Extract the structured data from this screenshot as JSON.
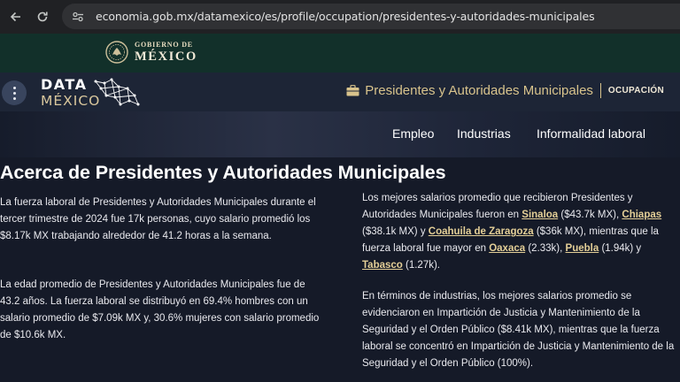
{
  "browser": {
    "url": "economia.gob.mx/datamexico/es/profile/occupation/presidentes-y-autoridades-municipales"
  },
  "gov": {
    "line1": "GOBIERNO DE",
    "line2": "MÉXICO"
  },
  "header": {
    "brand_top": "DATA",
    "brand_bottom": "MÉXICO",
    "profile_name": "Presidentes y Autoridades Municipales",
    "profile_type": "OCUPACIÓN"
  },
  "subnav": {
    "items": [
      "Empleo",
      "Industrias",
      "Informalidad laboral"
    ]
  },
  "about": {
    "title": "Acerca de Presidentes y Autoridades Municipales",
    "p1": "La fuerza laboral de Presidentes y Autoridades Municipales durante el tercer trimestre de 2024 fue 17k personas, cuyo salario promedió los $8.17k MX trabajando alrededor de 41.2 horas a la semana.",
    "p2": "La edad promedio de Presidentes y Autoridades Municipales fue de 43.2 años. La fuerza laboral se distribuyó en 69.4% hombres con un salario promedio de $7.09k MX y, 30.6% mujeres con salario promedio de $10.6k MX.",
    "p3": {
      "t1": "Los mejores salarios promedio que recibieron Presidentes y Autoridades Municipales fueron en ",
      "s1": "Sinaloa",
      "t2": " ($43.7k MX), ",
      "s2": "Chiapas",
      "t3": " ($38.1k MX) y ",
      "s3": "Coahuila de Zaragoza",
      "t4": " ($36k MX), mientras que la fuerza laboral fue mayor en ",
      "s4": "Oaxaca",
      "t5": " (2.33k), ",
      "s5": "Puebla",
      "t6": " (1.94k) y ",
      "s6": "Tabasco",
      "t7": " (1.27k)."
    },
    "p4": "En términos de industrias, los mejores salarios promedio se evidenciaron en Impartición de Justicia y Mantenimiento de la Seguridad y el Orden Público ($8.41k MX), mientras que la fuerza laboral se concentró en Impartición de Justicia y Mantenimiento de la Seguridad y el Orden Público (100%)."
  },
  "colors": {
    "accent_gold": "#d8c38c",
    "gov_band": "#12302a",
    "page_bg": "#151a28"
  }
}
